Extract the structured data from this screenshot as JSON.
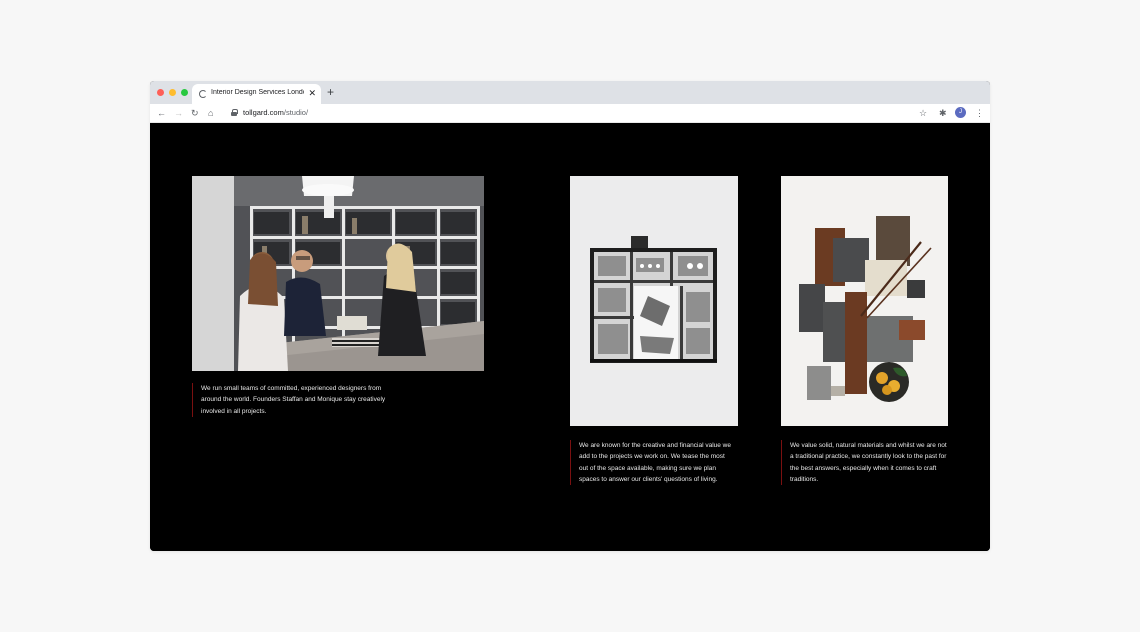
{
  "browser": {
    "tab_title": "Interior Design Services London",
    "url_domain": "tollgard.com",
    "url_path": "/studio/",
    "avatar_initial": "J",
    "icons": [
      "back-icon",
      "forward-icon",
      "reload-icon",
      "home-icon",
      "lock-icon",
      "star-icon",
      "extensions-icon",
      "menu-icon"
    ]
  },
  "sections": [
    {
      "image": "team-meeting-photo",
      "caption": "We run small teams of committed, experienced designers from around the world. Founders Staffan and Monique stay creatively involved in all projects."
    },
    {
      "image": "floor-plan-image",
      "caption": "We are known for the creative and financial value we add to the projects we work on. We tease the most out of the space available, making sure we plan spaces to answer our clients' questions of living."
    },
    {
      "image": "material-moodboard-image",
      "caption": "We value solid, natural materials and whilst we are not a traditional practice, we constantly look to the past for the best answers, especially when it comes to craft traditions."
    }
  ],
  "colors": {
    "background": "#000000",
    "caption_rule": "#7a1010",
    "caption_text": "#e8e8e8"
  }
}
